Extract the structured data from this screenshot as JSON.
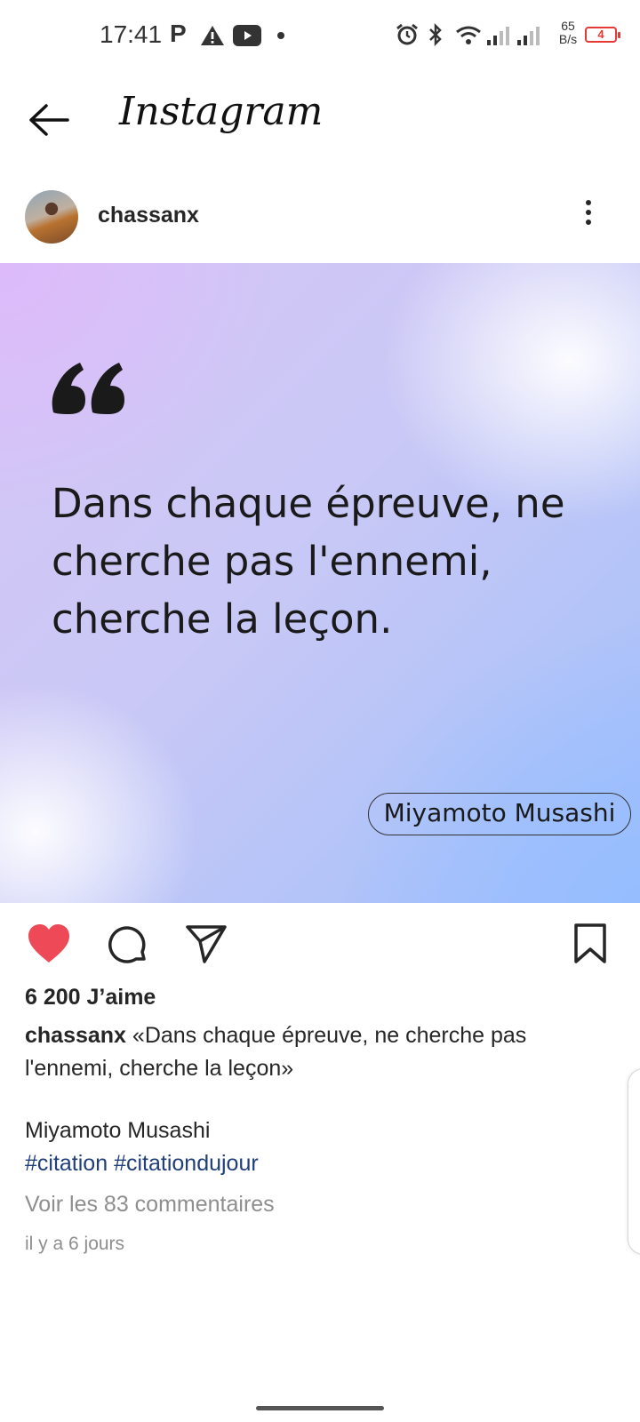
{
  "status_bar": {
    "time": "17:41",
    "p_label": "P",
    "net_speed_value": "65",
    "net_speed_unit": "B/s",
    "battery_level": "4",
    "icons": [
      "warning-icon",
      "youtube-icon",
      "dot-icon",
      "alarm-icon",
      "bluetooth-icon",
      "wifi-icon",
      "signal-icon",
      "signal-icon-2"
    ]
  },
  "header": {
    "title": "Instagram",
    "back_icon": "arrow-left-icon"
  },
  "post": {
    "username": "chassanx",
    "more_icon": "more-vertical-icon",
    "image": {
      "quote": "Dans chaque épreuve, ne cherche pas l'ennemi, cherche la leçon.",
      "author": "Miyamoto Musashi",
      "gradient_colors": [
        "#dcc0fa",
        "#c9c8f6",
        "#9fbcfd"
      ]
    },
    "actions": {
      "like_icon": "heart-filled-icon",
      "comment_icon": "comment-icon",
      "share_icon": "send-icon",
      "save_icon": "bookmark-icon",
      "liked_color": "#ed4956"
    },
    "likes": "6 200 J’aime",
    "caption_username": "chassanx",
    "caption_text": " «Dans chaque épreuve, ne cherche pas l'ennemi, cherche la leçon»",
    "caption_author": "Miyamoto Musashi",
    "hashtags": [
      "#citation",
      "#citationdujour"
    ],
    "view_comments": "Voir les 83 commentaires",
    "time_ago": "il y a 6 jours",
    "hashtag_color": "#1f3e7a"
  }
}
